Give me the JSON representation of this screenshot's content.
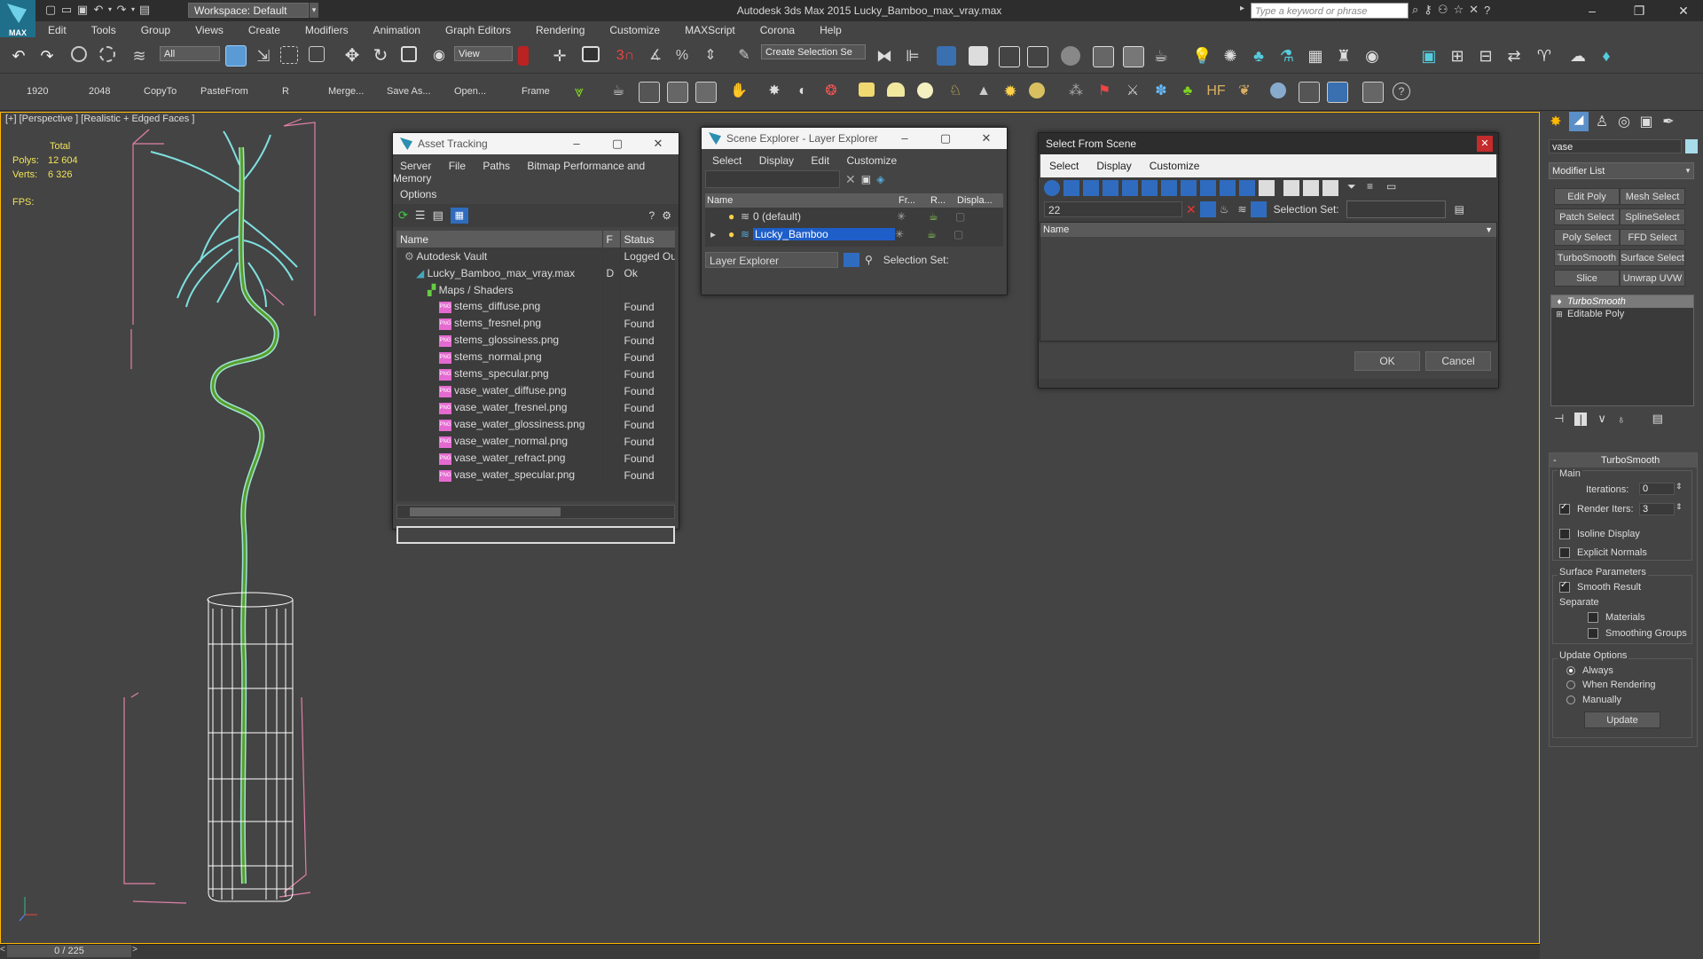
{
  "app": {
    "logo_text": "MAX",
    "workspace": "Workspace: Default",
    "title": "Autodesk 3ds Max  2015    Lucky_Bamboo_max_vray.max",
    "search_placeholder": "Type a keyword or phrase"
  },
  "menu": [
    "Edit",
    "Tools",
    "Group",
    "Views",
    "Create",
    "Modifiers",
    "Animation",
    "Graph Editors",
    "Rendering",
    "Customize",
    "MAXScript",
    "Corona",
    "Help"
  ],
  "toolbar1": {
    "filter": "All",
    "view": "View",
    "selection_set": "Create Selection Se"
  },
  "toolbar2": {
    "labels": [
      "1920",
      "2048",
      "CopyTo",
      "PasteFrom",
      "R",
      "Merge...",
      "Save As...",
      "Open...",
      "Frame"
    ]
  },
  "viewport": {
    "label": "[+] [Perspective ] [Realistic + Edged Faces ]",
    "stats_total": "Total",
    "polys_label": "Polys:",
    "polys_value": "12 604",
    "verts_label": "Verts:",
    "verts_value": "6 326",
    "fps_label": "FPS:"
  },
  "timeline": {
    "frame": "0 / 225"
  },
  "asset_tracking": {
    "title": "Asset Tracking",
    "menu": [
      "Server",
      "File",
      "Paths",
      "Bitmap Performance and Memory"
    ],
    "menu2": "Options",
    "columns": [
      "Name",
      "F",
      "Status"
    ],
    "rows": [
      {
        "name": "Autodesk Vault",
        "f": "",
        "status": "Logged Ou",
        "indent": 1,
        "type": "vault"
      },
      {
        "name": "Lucky_Bamboo_max_vray.max",
        "f": "D",
        "status": "Ok",
        "indent": 2,
        "type": "max"
      },
      {
        "name": "Maps / Shaders",
        "f": "",
        "status": "",
        "indent": 3,
        "type": "folder"
      },
      {
        "name": "stems_diffuse.png",
        "f": "",
        "status": "Found",
        "indent": 4,
        "type": "png"
      },
      {
        "name": "stems_fresnel.png",
        "f": "",
        "status": "Found",
        "indent": 4,
        "type": "png"
      },
      {
        "name": "stems_glossiness.png",
        "f": "",
        "status": "Found",
        "indent": 4,
        "type": "png"
      },
      {
        "name": "stems_normal.png",
        "f": "",
        "status": "Found",
        "indent": 4,
        "type": "png"
      },
      {
        "name": "stems_specular.png",
        "f": "",
        "status": "Found",
        "indent": 4,
        "type": "png"
      },
      {
        "name": "vase_water_diffuse.png",
        "f": "",
        "status": "Found",
        "indent": 4,
        "type": "png"
      },
      {
        "name": "vase_water_fresnel.png",
        "f": "",
        "status": "Found",
        "indent": 4,
        "type": "png"
      },
      {
        "name": "vase_water_glossiness.png",
        "f": "",
        "status": "Found",
        "indent": 4,
        "type": "png"
      },
      {
        "name": "vase_water_normal.png",
        "f": "",
        "status": "Found",
        "indent": 4,
        "type": "png"
      },
      {
        "name": "vase_water_refract.png",
        "f": "",
        "status": "Found",
        "indent": 4,
        "type": "png"
      },
      {
        "name": "vase_water_specular.png",
        "f": "",
        "status": "Found",
        "indent": 4,
        "type": "png"
      }
    ]
  },
  "scene_explorer": {
    "title": "Scene Explorer - Layer Explorer",
    "menu": [
      "Select",
      "Display",
      "Edit",
      "Customize"
    ],
    "columns": [
      "Name",
      "Fr...",
      "R...",
      "Displa..."
    ],
    "layers": [
      "0 (default)",
      "Lucky_Bamboo"
    ],
    "footer_dropdown": "Layer Explorer",
    "selection_set_label": "Selection Set:"
  },
  "select_from_scene": {
    "title": "Select From Scene",
    "menu": [
      "Select",
      "Display",
      "Customize"
    ],
    "search_value": "22",
    "selection_set_label": "Selection Set:",
    "column": "Name",
    "ok": "OK",
    "cancel": "Cancel"
  },
  "command_panel": {
    "name_value": "vase",
    "modifier_list": "Modifier List",
    "buttons": [
      "Edit Poly",
      "Mesh Select",
      "Patch Select",
      "SplineSelect",
      "Poly Select",
      "FFD Select",
      "TurboSmooth",
      "Surface Select",
      "Slice",
      "Unwrap UVW"
    ],
    "stack": [
      "TurboSmooth",
      "Editable Poly"
    ],
    "rollout_title": "TurboSmooth",
    "main_label": "Main",
    "iterations_label": "Iterations:",
    "iterations_value": "0",
    "render_iters_label": "Render Iters:",
    "render_iters_value": "3",
    "isoline": "Isoline Display",
    "explicit_normals": "Explicit Normals",
    "surface_params": "Surface Parameters",
    "smooth_result": "Smooth Result",
    "separate": "Separate",
    "materials": "Materials",
    "smoothing_groups": "Smoothing Groups",
    "update_options": "Update Options",
    "always": "Always",
    "when_rendering": "When Rendering",
    "manually": "Manually",
    "update_button": "Update"
  },
  "colors": {
    "accent": "#ffb700",
    "selection": "#1e5ec8",
    "stat_text": "#f0e35a",
    "wire_plant": "#7fe0e0",
    "wire_vase": "#ffffff",
    "bbox": "#e080a8"
  }
}
